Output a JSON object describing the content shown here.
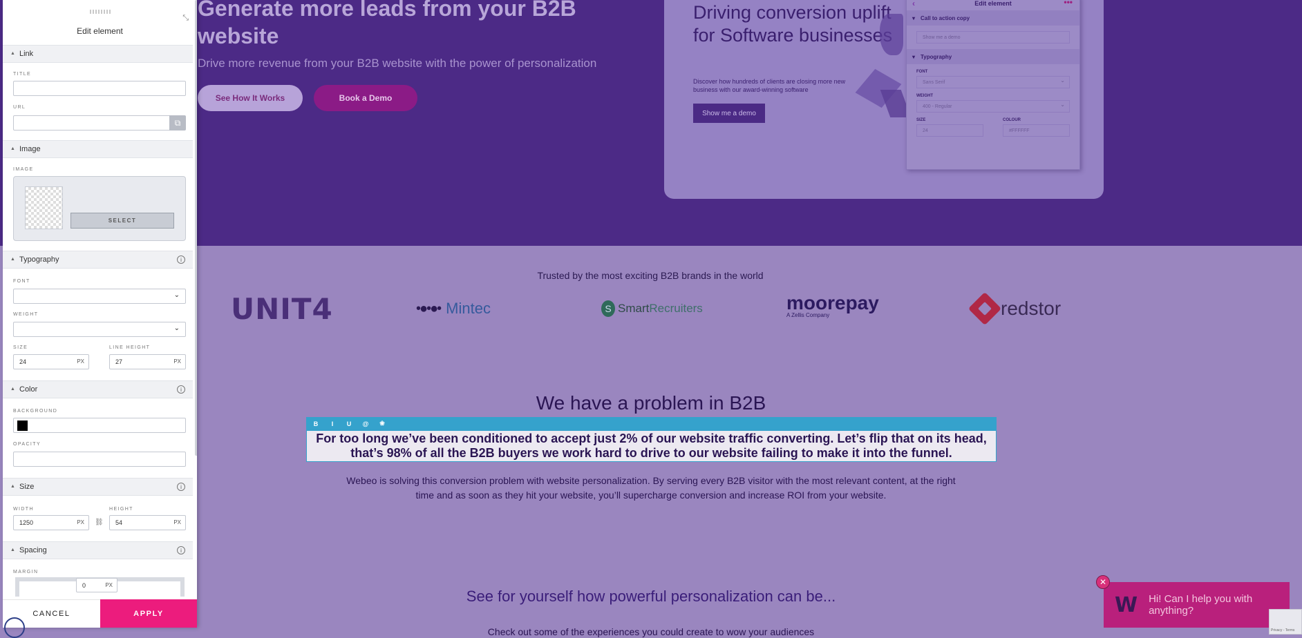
{
  "hero": {
    "title": "Generate more leads from your B2B website",
    "subtitle": "Drive more revenue from your B2B website with the power of personalization",
    "btn_how": "See How It Works",
    "btn_demo": "Book a Demo",
    "card": {
      "title": "Driving conversion uplift for Software businesses",
      "description": "Discover how hundreds of clients are closing more new business with our award-winning software",
      "button": "Show me a demo",
      "mini_panel": {
        "title": "Edit element",
        "section_cta": "Call to action copy",
        "cta_value": "Show me a demo",
        "section_typography": "Typography",
        "font_label": "FONT",
        "font_value": "Sans Serif",
        "weight_label": "WEIGHT",
        "weight_value": "400 - Regular",
        "size_label": "SIZE",
        "size_value": "24",
        "colour_label": "COLOUR",
        "colour_value": "#FFFFFF"
      }
    }
  },
  "trusted": {
    "heading": "Trusted by the most exciting B2B brands in the world",
    "logos": {
      "unit4": "UNIT4",
      "mintec": "Mintec",
      "smart": "Smart",
      "recruiters": "Recruiters",
      "moorepay": "moorepay",
      "moorepay_sub": "A Zellis Company",
      "redstor": "redstor"
    }
  },
  "problem": {
    "title": "We have a problem in B2B",
    "toolbar": [
      "B",
      "I",
      "U",
      "@",
      "❀"
    ],
    "editable_text": "For too long we’ve been conditioned to accept just 2% of our website traffic converting. Let’s flip that on its head, that’s 98% of all the B2B buyers we work hard to drive to our website failing to make it into the funnel.",
    "body": "Webeo is solving this conversion problem with website personalization. By serving every B2B visitor with the most relevant content, at the right time and as soon as they hit your website, you’ll supercharge conversion and increase ROI from your website."
  },
  "see": {
    "title": "See for yourself how powerful personalization can be...",
    "subtitle": "Check out some of the experiences you could create to wow your audiences"
  },
  "chat": {
    "logo": "W",
    "message": "Hi! Can I help you with anything?",
    "close": "✕",
    "recaptcha": "Privacy - Terms"
  },
  "panel": {
    "title": "Edit element",
    "sections": {
      "link": "Link",
      "image": "Image",
      "typography": "Typography",
      "color": "Color",
      "size": "Size",
      "spacing": "Spacing"
    },
    "link": {
      "title_label": "TITLE",
      "title_value": "",
      "url_label": "URL",
      "url_value": ""
    },
    "image": {
      "label": "IMAGE",
      "select": "SELECT"
    },
    "typography": {
      "font_label": "FONT",
      "font_value": "",
      "weight_label": "WEIGHT",
      "weight_value": "",
      "size_label": "SIZE",
      "size_value": "24",
      "line_height_label": "LINE HEIGHT",
      "line_height_value": "27",
      "unit": "PX"
    },
    "color": {
      "background_label": "BACKGROUND",
      "background_value": "#000000",
      "opacity_label": "OPACITY",
      "opacity_value": ""
    },
    "size": {
      "width_label": "WIDTH",
      "width_value": "1250",
      "height_label": "HEIGHT",
      "height_value": "54",
      "unit": "PX"
    },
    "spacing": {
      "margin_label": "MARGIN",
      "margin_value": "0",
      "unit": "PX"
    },
    "cancel": "CANCEL",
    "apply": "APPLY"
  }
}
